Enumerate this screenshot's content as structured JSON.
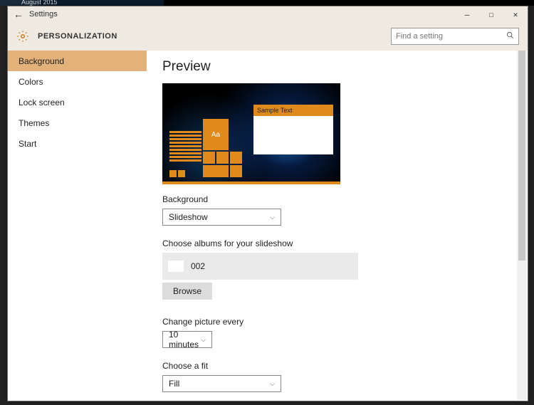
{
  "taskbar_hint": "August                2015",
  "window": {
    "title": "Settings",
    "min": "—",
    "max": "☐",
    "close": "✕"
  },
  "header": {
    "title": "PERSONALIZATION",
    "search_placeholder": "Find a setting"
  },
  "sidebar": {
    "items": [
      {
        "label": "Background",
        "active": true
      },
      {
        "label": "Colors",
        "active": false
      },
      {
        "label": "Lock screen",
        "active": false
      },
      {
        "label": "Themes",
        "active": false
      },
      {
        "label": "Start",
        "active": false
      }
    ]
  },
  "main": {
    "preview_heading": "Preview",
    "preview_sample": "Sample Text",
    "preview_aa": "Aa",
    "background_label": "Background",
    "background_value": "Slideshow",
    "albums_label": "Choose albums for your slideshow",
    "album_name": "002",
    "browse_label": "Browse",
    "change_label": "Change picture every",
    "change_value": "10 minutes",
    "fit_label": "Choose a fit",
    "fit_value": "Fill"
  }
}
